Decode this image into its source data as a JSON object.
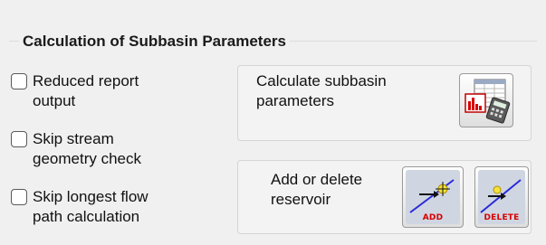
{
  "panel": {
    "title": "Calculation of Subbasin Parameters"
  },
  "options": [
    {
      "label": "Reduced  report\noutput",
      "checked": false
    },
    {
      "label": "Skip stream\ngeometry check",
      "checked": false
    },
    {
      "label": "Skip longest flow\npath calculation",
      "checked": false
    }
  ],
  "calc_group": {
    "label": "Calculate subbasin\nparameters",
    "button_icon": "spreadsheet-chart-calculator-icon"
  },
  "reservoir_group": {
    "label": "Add or delete\nreservoir",
    "add_button": {
      "label": "ADD",
      "icon": "add-reservoir-icon"
    },
    "delete_button": {
      "label": "DELETE",
      "icon": "delete-reservoir-icon"
    }
  },
  "colors": {
    "icon_blue": "#2a2ad8",
    "icon_red": "#d80000",
    "icon_yellow": "#f4e23a",
    "button_tile": "#cfd6e2"
  }
}
